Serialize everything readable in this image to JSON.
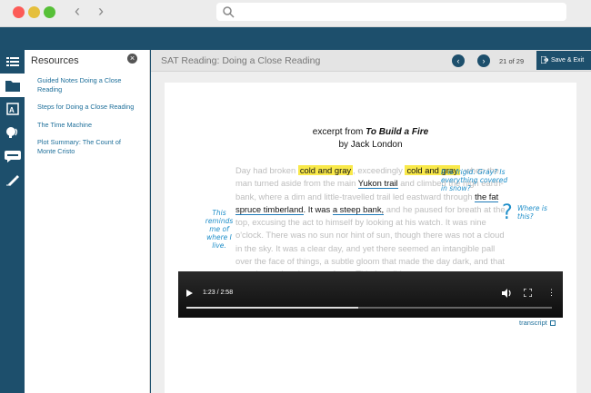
{
  "browser": {
    "back_label": "‹",
    "forward_label": "›"
  },
  "colors": {
    "brand": "#1d4f6c",
    "highlight": "#f9e94a",
    "annotation": "#1e8ec9",
    "link": "#1e6f9a"
  },
  "rail": {
    "icons": [
      "list-icon",
      "folder-icon",
      "glossary-icon",
      "listen-icon",
      "note-icon",
      "pen-icon"
    ],
    "active": "folder-icon"
  },
  "resources": {
    "title": "Resources",
    "links": [
      "Guided Notes Doing a Close Reading",
      "Steps for Doing a Close Reading",
      "The Time Machine",
      "Plot Summary: The Count of Monte Cristo"
    ]
  },
  "lesson": {
    "title": "SAT Reading: Doing a Close Reading",
    "current_page": "21",
    "of_label": "of",
    "total_pages": "29",
    "save_exit": "Save & Exit"
  },
  "excerpt": {
    "prefix": "excerpt from",
    "book": "To Build a Fire",
    "author": "by Jack London"
  },
  "passage": {
    "p1": "Day had broken",
    "h1": "cold and gray",
    "p2": ", exceedingly",
    "h2": "cold and gray",
    "p3": ", when the man turned aside from the main",
    "u1": "Yukon trail",
    "p4": "and climbed the high earth-bank, where a dim and little-travelled trail led eastward through",
    "u2": "the fat spruce timberland",
    "d1": ". It was",
    "u3": "a steep bank,",
    "p5": "and he paused for breath at the top, excusing the act to himself by looking at his watch. It was nine o'clock. There was no sun nor hint of sun, though there was not a cloud in the sky. It was a clear day, and yet there seemed an intangible pall over the face of things, a subtle gloom that made the day dark, and that was due to the absence of sun. This fact did"
  },
  "annotations": {
    "left": "This reminds me of where I live.",
    "top": "It is frigid. Gray? Is everything covered in snow?",
    "question": "?",
    "right": "Where is this?"
  },
  "video": {
    "time": "1:23 / 2:58",
    "progress": 0.47,
    "more": "⋮"
  },
  "transcript_label": "transcript"
}
